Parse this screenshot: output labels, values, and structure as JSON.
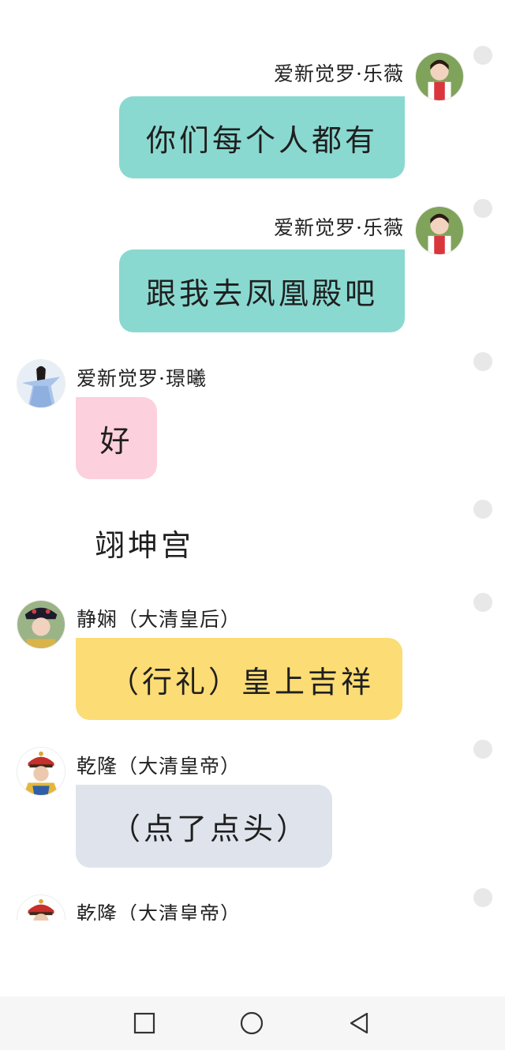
{
  "colors": {
    "bubble_teal": "#8ad9d1",
    "bubble_pink": "#fdd0dd",
    "bubble_yellow": "#fcdc75",
    "bubble_gray": "#dfe4ec",
    "select_dot": "#e8e8e8",
    "navbar_bg": "#f6f6f6"
  },
  "messages": [
    {
      "sender": "爱新觉罗·乐薇",
      "text": "你们每个人都有",
      "side": "right",
      "avatar_icon": "character-avatar-lewei"
    },
    {
      "sender": "爱新觉罗·乐薇",
      "text": "跟我去凤凰殿吧",
      "side": "right",
      "avatar_icon": "character-avatar-lewei"
    },
    {
      "sender": "爱新觉罗·璟曦",
      "text": "好",
      "side": "left",
      "avatar_icon": "character-avatar-jingxi"
    },
    {
      "narration": "翊坤宫"
    },
    {
      "sender": "静娴（大清皇后）",
      "text": "（行礼）皇上吉祥",
      "side": "left",
      "avatar_icon": "character-avatar-empress"
    },
    {
      "sender": "乾隆（大清皇帝）",
      "text": "（点了点头）",
      "side": "left",
      "avatar_icon": "character-avatar-emperor"
    },
    {
      "sender": "乾隆（大清皇帝）",
      "text": "",
      "side": "left",
      "avatar_icon": "character-avatar-emperor"
    }
  ],
  "navbar": {
    "recents_icon": "square-recents-icon",
    "home_icon": "circle-home-icon",
    "back_icon": "triangle-back-icon"
  }
}
